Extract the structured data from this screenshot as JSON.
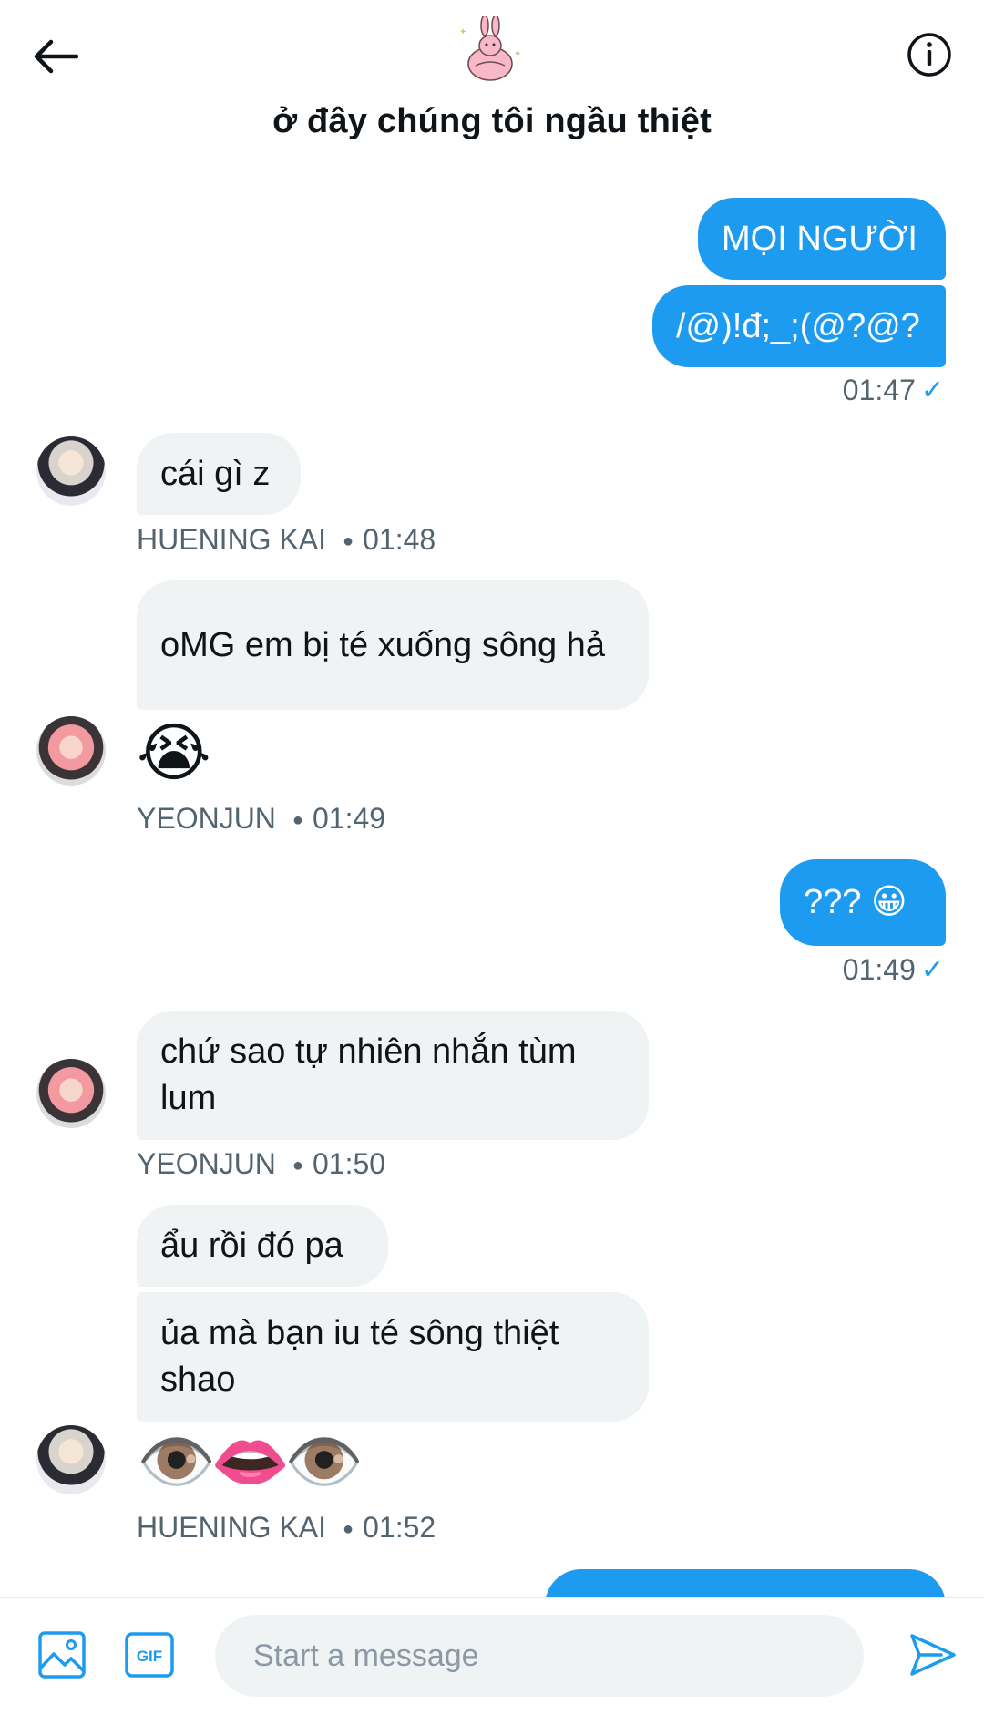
{
  "header": {
    "title": "ở đây chúng tôi ngầu thiệt",
    "back_icon": "arrow-left-icon",
    "info_icon": "info-circle-icon"
  },
  "messages": {
    "m1": "MỌI NGƯỜI",
    "m2": "/@)!đ;_;(@?@?",
    "m2_time": "01:47",
    "m3": "cái gì z",
    "m3_sender": "HUENING KAI",
    "m3_time": "01:48",
    "m4": "oMG em bị té xuống sông hả",
    "m5": "😭",
    "m5_sender": "YEONJUN",
    "m5_time": "01:49",
    "m6": "??? 😀",
    "m6_time": "01:49",
    "m7": "chứ sao tự nhiên nhắn tùm lum",
    "m7_sender": "YEONJUN",
    "m7_time": "01:50",
    "m8": "ẩu rồi đó pa",
    "m9": "ủa mà bạn iu té sông thiệt shao",
    "m10": "👁️👄👁️",
    "m10_sender": "HUENING KAI",
    "m10_time": "01:52"
  },
  "composer": {
    "placeholder": "Start a message",
    "image_icon": "image-icon",
    "gif_icon": "gif-icon",
    "gif_label": "GIF",
    "send_icon": "send-icon"
  },
  "colors": {
    "accent": "#1d9bf0",
    "incoming_bg": "#eff3f4",
    "meta_text": "#536471"
  }
}
